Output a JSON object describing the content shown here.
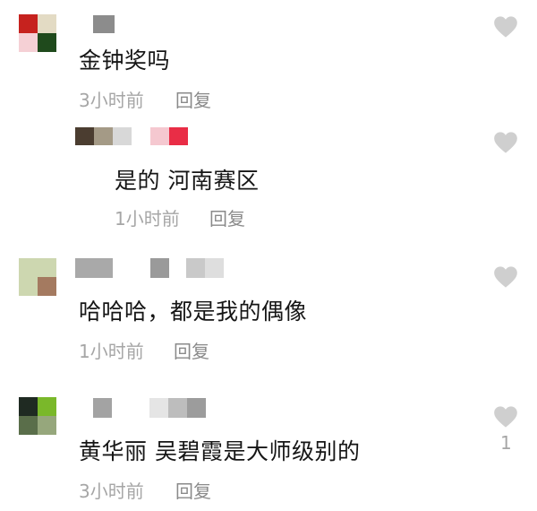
{
  "comments": [
    {
      "text": "金钟奖吗",
      "time": "3小时前",
      "reply_label": "回复",
      "avatar_colors": [
        "#c6221e",
        "#e3dbc4",
        "#f5d0d5",
        "#1f4a1c"
      ],
      "name_colors": [
        "#8c8c8c"
      ]
    },
    {
      "text": "是的 河南赛区",
      "time": "1小时前",
      "reply_label": "回复",
      "name_colors": [
        "#4b3d30",
        "#a49a86",
        "#d8d8d8",
        "#f5c8d0",
        "#e92d46"
      ]
    },
    {
      "text": "哈哈哈，都是我的偶像",
      "time": "1小时前",
      "reply_label": "回复",
      "avatar_colors": [
        "#cdd7b0",
        "#a47a60"
      ],
      "name_colors": [
        "#a9a9a9",
        "#9a9a9a",
        "#c9c9c9",
        "#dedede"
      ]
    },
    {
      "text": "黄华丽 吴碧霞是大师级别的",
      "time": "3小时前",
      "reply_label": "回复",
      "like_count": "1",
      "avatar_colors": [
        "#1f2a22",
        "#7ab82a",
        "#5a6e4a",
        "#96a77c"
      ],
      "name_colors": [
        "#a3a3a3",
        "#e5e5e5",
        "#bdbdbd",
        "#9c9c9c"
      ]
    }
  ],
  "icons": {
    "like": "heart-icon"
  },
  "colors": {
    "heart": "#cfcfcf"
  }
}
